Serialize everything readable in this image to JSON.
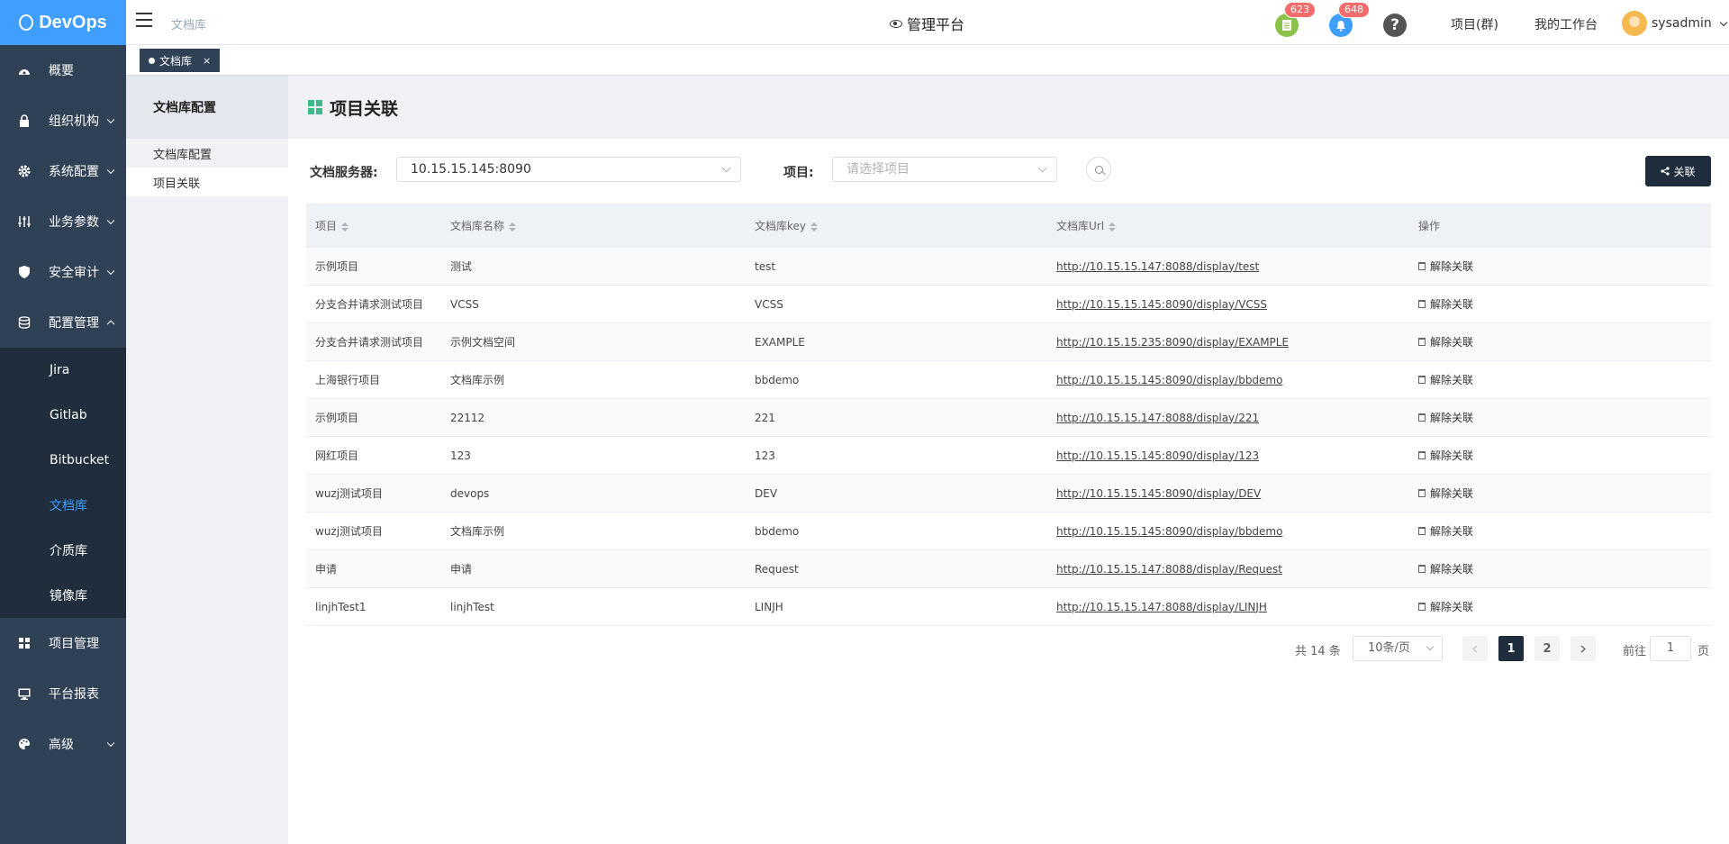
{
  "sidebar": {
    "logo": "DevOps",
    "items": [
      {
        "label": "概要",
        "icon": "dashboard-icon"
      },
      {
        "label": "组织机构",
        "icon": "lock-icon"
      },
      {
        "label": "系统配置",
        "icon": "gear-icon"
      },
      {
        "label": "业务参数",
        "icon": "sliders-icon"
      },
      {
        "label": "安全审计",
        "icon": "shield-icon"
      },
      {
        "label": "配置管理",
        "icon": "database-icon"
      }
    ],
    "submenu": [
      "Jira",
      "Gitlab",
      "Bitbucket",
      "文档库",
      "介质库",
      "镜像库"
    ],
    "bottom_items": [
      {
        "label": "项目管理",
        "icon": "grid-icon"
      },
      {
        "label": "平台报表",
        "icon": "monitor-icon"
      },
      {
        "label": "高级",
        "icon": "palette-icon"
      }
    ]
  },
  "header": {
    "breadcrumb": "文档库",
    "platform": "管理平台",
    "badge_todo": "623",
    "badge_notice": "648",
    "help": "?",
    "link_projects": "项目(群)",
    "link_workspace": "我的工作台",
    "username": "sysadmin"
  },
  "tagbar": {
    "tag": "文档库",
    "close": "×"
  },
  "subnav": {
    "title": "文档库配置",
    "items": [
      "文档库配置",
      "项目关联"
    ]
  },
  "main": {
    "title": "项目关联",
    "server_label": "文档服务器:",
    "server_value": "10.15.15.145:8090",
    "project_label": "项目:",
    "project_placeholder": "请选择项目",
    "link_button": "关联",
    "columns": [
      "项目",
      "文档库名称",
      "文档库key",
      "文档库Url",
      "操作"
    ],
    "action_label": "解除关联",
    "rows": [
      [
        "示例项目",
        "测试",
        "test",
        "http://10.15.15.147:8088/display/test"
      ],
      [
        "分支合并请求测试项目",
        "VCSS",
        "VCSS",
        "http://10.15.15.145:8090/display/VCSS"
      ],
      [
        "分支合并请求测试项目",
        "示例文档空间",
        "EXAMPLE",
        "http://10.15.15.235:8090/display/EXAMPLE"
      ],
      [
        "上海银行项目",
        "文档库示例",
        "bbdemo",
        "http://10.15.15.145:8090/display/bbdemo"
      ],
      [
        "示例项目",
        "22112",
        "221",
        "http://10.15.15.147:8088/display/221"
      ],
      [
        "网红项目",
        "123",
        "123",
        "http://10.15.15.145:8090/display/123"
      ],
      [
        "wuzj测试项目",
        "devops",
        "DEV",
        "http://10.15.15.145:8090/display/DEV"
      ],
      [
        "wuzj测试项目",
        "文档库示例",
        "bbdemo",
        "http://10.15.15.145:8090/display/bbdemo"
      ],
      [
        "申请",
        "申请",
        "Request",
        "http://10.15.15.147:8088/display/Request"
      ],
      [
        "linjhTest1",
        "linjhTest",
        "LINJH",
        "http://10.15.15.147:8088/display/LINJH"
      ]
    ],
    "pagination": {
      "total": "共 14 条",
      "page_size": "10条/页",
      "pages": [
        "1",
        "2"
      ],
      "goto_prefix": "前往",
      "goto_value": "1",
      "goto_suffix": "页"
    }
  },
  "colors": {
    "accent": "#409eff",
    "sidebar": "#304156",
    "dark": "#1f2d3d",
    "danger": "#f56c6c"
  }
}
